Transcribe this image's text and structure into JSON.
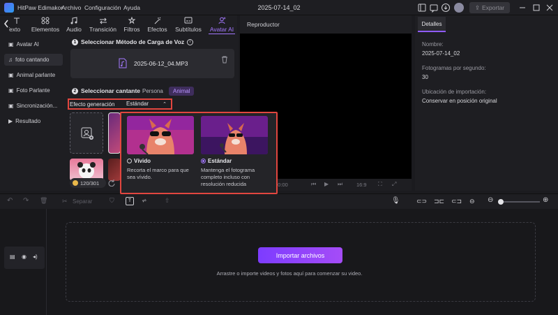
{
  "app": {
    "name": "HitPaw Edimakor",
    "menu": [
      "Archivo",
      "Configuración",
      "Ayuda"
    ],
    "project_title": "2025-07-14_02",
    "export_label": "Exportar"
  },
  "toolbar": {
    "tabs": [
      {
        "label": "Texto",
        "icon": "text-icon"
      },
      {
        "label": "Elementos",
        "icon": "elements-icon"
      },
      {
        "label": "Audio",
        "icon": "music-note-icon"
      },
      {
        "label": "Transición",
        "icon": "transition-icon"
      },
      {
        "label": "Filtros",
        "icon": "filter-icon"
      },
      {
        "label": "Efectos",
        "icon": "effects-icon"
      },
      {
        "label": "Subtítulos",
        "icon": "subtitles-icon"
      },
      {
        "label": "Avatar AI",
        "icon": "avatar-ai-icon"
      }
    ],
    "active": "Avatar AI"
  },
  "sidebar": {
    "items": [
      {
        "label": "Avatar AI",
        "icon": "avatar-icon"
      },
      {
        "label": "foto cantando",
        "icon": "music-photo-icon"
      },
      {
        "label": "Animal parlante",
        "icon": "animal-icon"
      },
      {
        "label": "Foto Parlante",
        "icon": "photo-talk-icon"
      },
      {
        "label": "Sincronización...",
        "icon": "sync-icon"
      },
      {
        "label": "Resultado",
        "icon": "result-icon"
      }
    ],
    "active": "foto cantando"
  },
  "panel": {
    "step1_title": "Seleccionar Método de Carga de Voz",
    "file_name": "2025-06-12_04.MP3",
    "step2_title": "Seleccionar cantante",
    "singer_options": [
      "Persona",
      "Animal"
    ],
    "singer_selected": "Animal",
    "effect_label": "Efecto generación",
    "effect_value": "Estándar",
    "credits": "120/301"
  },
  "popup": {
    "options": [
      {
        "title": "Vívido",
        "desc": "Recorta el marco para que sea vívido.",
        "selected": false
      },
      {
        "title": "Estándar",
        "desc": "Mantenga el fotograma completo incluso con resolución reducida",
        "selected": true
      }
    ]
  },
  "preview": {
    "header": "Reproductor",
    "time": "00:00",
    "ratio": "16:9"
  },
  "details": {
    "tab": "Detalles",
    "fields": [
      {
        "label": "Nombre:",
        "value": "2025-07-14_02"
      },
      {
        "label": "Fotogramas por segundo:",
        "value": "30"
      },
      {
        "label": "Ubicación de importación:",
        "value": "Conservar en posición original"
      }
    ]
  },
  "timeline": {
    "split_label": "Separar",
    "import_label": "Importar archivos",
    "drop_hint": "Arrastre o importe videos y fotos aquí para comenzar su video."
  },
  "colors": {
    "accent": "#a478ff",
    "highlight": "#e2463f",
    "bg": "#1b1b1f",
    "panel": "#1e1e22"
  }
}
